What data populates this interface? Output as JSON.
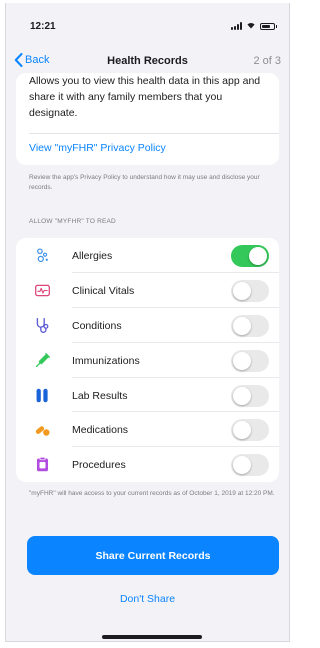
{
  "status_bar": {
    "time": "12:21"
  },
  "nav": {
    "back_label": "Back",
    "title": "Health Records",
    "step": "2 of 3"
  },
  "intro": {
    "description": "Allows you to view this health data in this app and share it with any family members that you designate.",
    "policy_link": "View \"myFHR\" Privacy Policy"
  },
  "review_note": "Review the app's Privacy Policy to understand how it may use and disclose your records.",
  "section_header": "ALLOW \"MYFHR\" TO READ",
  "permissions": [
    {
      "label": "Allergies",
      "icon": "allergies-icon",
      "enabled": true
    },
    {
      "label": "Clinical Vitals",
      "icon": "clinical-vitals-icon",
      "enabled": false
    },
    {
      "label": "Conditions",
      "icon": "conditions-stethoscope-icon",
      "enabled": false
    },
    {
      "label": "Immunizations",
      "icon": "immunizations-syringe-icon",
      "enabled": false
    },
    {
      "label": "Lab Results",
      "icon": "lab-results-tubes-icon",
      "enabled": false
    },
    {
      "label": "Medications",
      "icon": "medications-pills-icon",
      "enabled": false
    },
    {
      "label": "Procedures",
      "icon": "procedures-clipboard-icon",
      "enabled": false
    }
  ],
  "access_note": "\"myFHR\" will have access to your current records as of October 1, 2019 at 12:20 PM.",
  "share_button": "Share Current Records",
  "dont_share": "Don't Share",
  "colors": {
    "accent": "#0a84ff",
    "toggle_on": "#34c759",
    "toggle_off": "#e9e9ea",
    "background": "#f2f2f7"
  }
}
